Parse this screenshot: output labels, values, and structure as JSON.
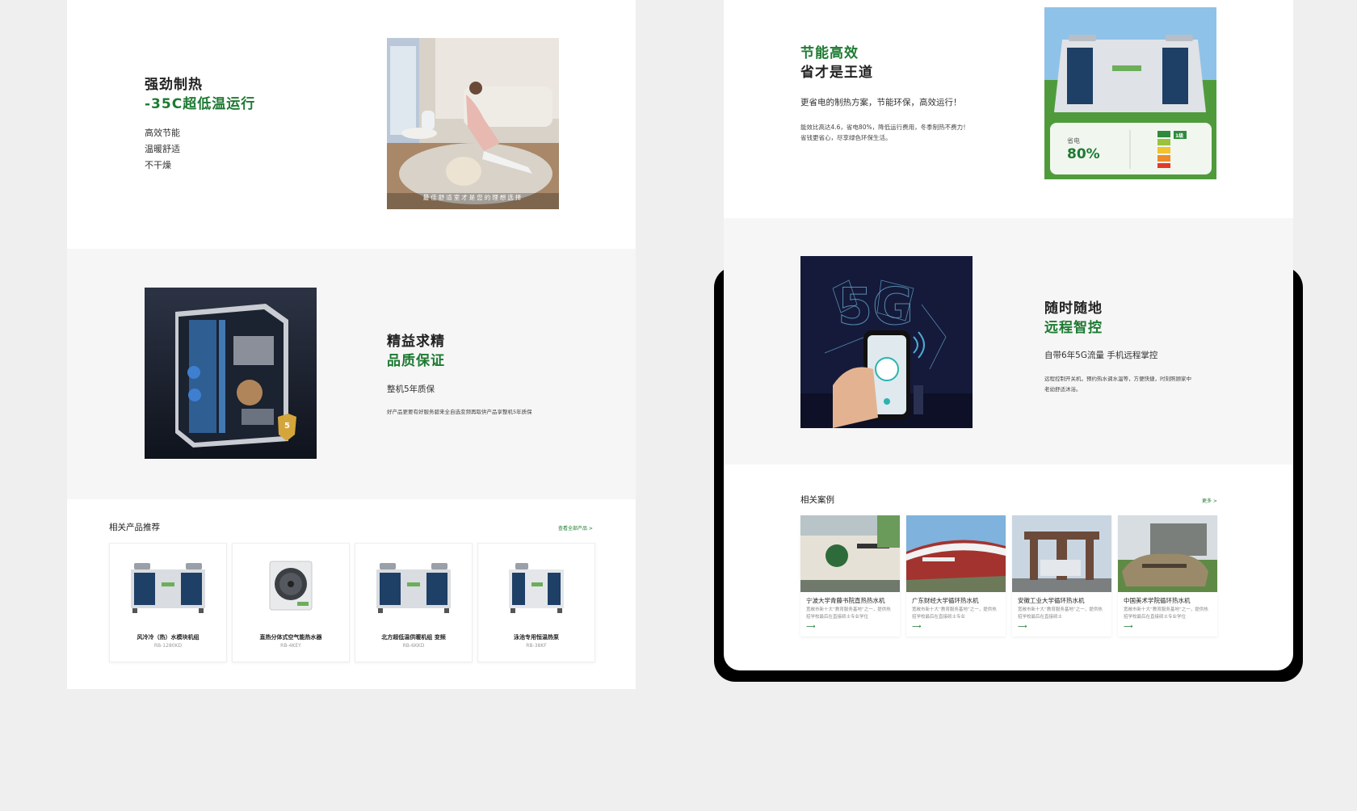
{
  "left": {
    "s1": {
      "title": "强劲制热",
      "subtitle": "-35C超低温运行",
      "features": [
        "高效节能",
        "温暖舒适",
        "不干燥"
      ],
      "image_caption": "最佳舒适室才是您的理想选择"
    },
    "s2": {
      "title": "精益求精",
      "subtitle": "品质保证",
      "lead": "整机5年质保",
      "desc": "好产品更要有好服务碧来全自选变频再取供产品享整机5年质保",
      "badge": "5"
    },
    "related": {
      "title": "相关产品推荐",
      "more": "查看全部产品 >",
      "products": [
        {
          "name": "风冷冷（热）水模块机组",
          "model": "RB-1280KD"
        },
        {
          "name": "直热分体式空气能热水器",
          "model": "RB-4KEY"
        },
        {
          "name": "北方超低温供暖机组 变频",
          "model": "RB-6KKD"
        },
        {
          "name": "泳池专用恒温热泵",
          "model": "RB-38KF"
        }
      ]
    }
  },
  "right": {
    "s1": {
      "title": "节能高效",
      "subtitle": "省才是王道",
      "lead": "更省电的制热方案，节能环保，高效运行！",
      "desc": [
        "能效比高达4.6，省电80%，降低运行费用，冬季制热不费力！",
        "省钱更省心，尽享绿色环保生活。"
      ],
      "saving_label": "省电",
      "saving_value": "80%",
      "energy_grade": "1级"
    },
    "s2": {
      "title": "随时随地",
      "subtitle": "远程智控",
      "lead": "自带6年5G流量 手机远程掌控",
      "desc": [
        "远程控制开关机，预约热水调水温等，方便快捷，时刻照顾家中",
        "老幼舒适沐浴。"
      ],
      "image_text": "5G"
    },
    "cases": {
      "title": "相关案例",
      "more": "更多 >",
      "items": [
        {
          "title": "宁波大学青藤书院直热热水机",
          "desc": "宽敞市新十大“教育服务基地”之一，提供热招学校最后在直接硕士专业学位"
        },
        {
          "title": "广东财经大学循环热水机",
          "desc": "宽敞市新十大“教育服务基地”之一，提供热招学校最后在直接硕士专业"
        },
        {
          "title": "安徽工业大学循环热水机",
          "desc": "宽敞市新十大“教育服务基地”之一，提供热招学校最后在直接硕士"
        },
        {
          "title": "中国美术学院循环热水机",
          "desc": "宽敞市新十大“教育服务基地”之一，提供热招学校最后在直接硕士专业学位"
        }
      ],
      "arrow": "⟶"
    }
  },
  "colors": {
    "green": "#1d7a32",
    "background": "#efefef",
    "tablet_frame": "#000000"
  }
}
